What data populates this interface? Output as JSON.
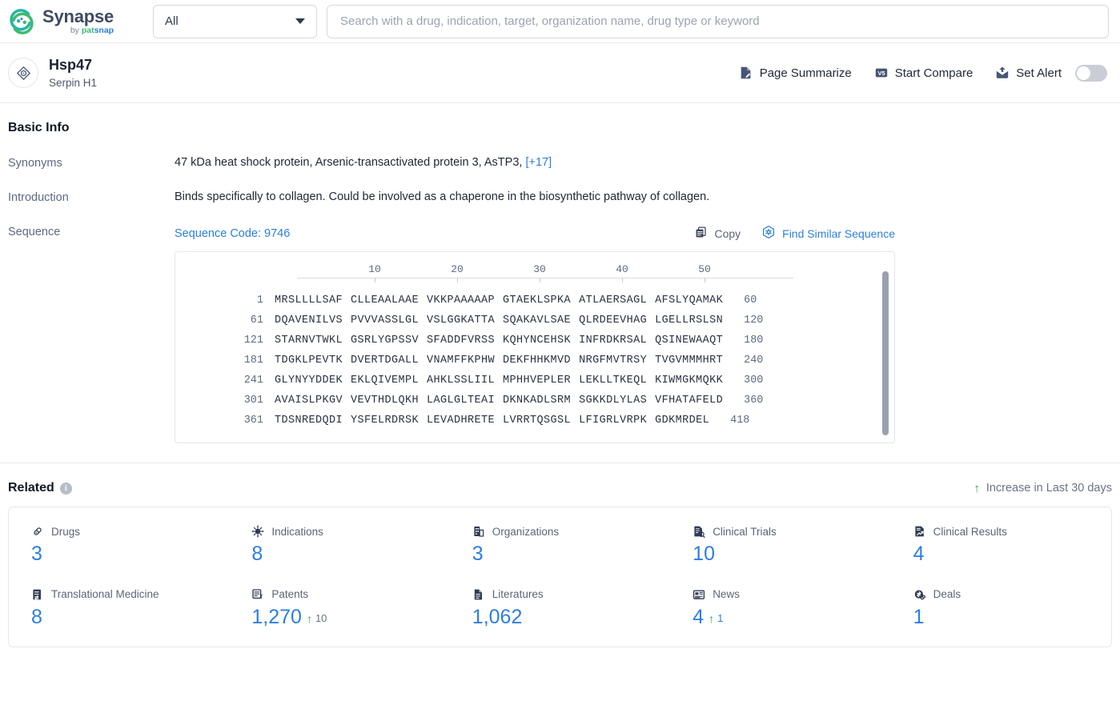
{
  "brand": {
    "name": "Synapse",
    "by": "by ",
    "pat": "pat",
    "snap": "snap",
    "logo_icon": "synapse-swoosh-icon"
  },
  "search": {
    "scope_value": "All",
    "scope_icon": "chevron-down-icon",
    "placeholder": "Search with a drug, indication, target, organization name, drug type or keyword",
    "value": ""
  },
  "entity": {
    "icon": "target-crosshair-icon",
    "title": "Hsp47",
    "subtitle": "Serpin H1",
    "actions": [
      {
        "label": "Page Summarize",
        "icon": "page-summarize-icon"
      },
      {
        "label": "Start Compare",
        "icon": "v5-compare-icon"
      },
      {
        "label": "Set Alert",
        "icon": "alert-envelope-icon"
      }
    ],
    "alert_toggle_state": "off"
  },
  "basic_info": {
    "title": "Basic Info",
    "synonyms": {
      "label": "Synonyms",
      "value": "47 kDa heat shock protein,  Arsenic-transactivated protein 3,  AsTP3,",
      "more": "[+17]"
    },
    "introduction": {
      "label": "Introduction",
      "value": "Binds specifically to collagen. Could be involved as a chaperone in the biosynthetic pathway of collagen."
    },
    "sequence": {
      "label": "Sequence",
      "code_label": "Sequence Code: 9746",
      "copy_label": "Copy",
      "copy_icon": "copy-icon",
      "find_similar_label": "Find Similar Sequence",
      "find_similar_icon": "hexagon-similar-icon",
      "ruler_ticks": [
        "10",
        "20",
        "30",
        "40",
        "50"
      ],
      "rows": [
        {
          "start": "1",
          "blocks": [
            "MRSLLLLSAF",
            "CLLEAALAAE",
            "VKKPAAAAAP",
            "GTAEKLSPKA",
            "ATLAERSAGL",
            "AFSLYQAMAK"
          ],
          "end": "60"
        },
        {
          "start": "61",
          "blocks": [
            "DQAVENILVS",
            "PVVVASSLGL",
            "VSLGGKATTA",
            "SQAKAVLSAE",
            "QLRDEEVHAG",
            "LGELLRSLSN"
          ],
          "end": "120"
        },
        {
          "start": "121",
          "blocks": [
            "STARNVTWKL",
            "GSRLYGPSSV",
            "SFADDFVRSS",
            "KQHYNCEHSK",
            "INFRDKRSAL",
            "QSINEWAAQT"
          ],
          "end": "180"
        },
        {
          "start": "181",
          "blocks": [
            "TDGKLPEVTK",
            "DVERTDGALL",
            "VNAMFFKPHW",
            "DEKFHHKMVD",
            "NRGFMVTRSY",
            "TVGVMMMHRT"
          ],
          "end": "240"
        },
        {
          "start": "241",
          "blocks": [
            "GLYNYYDDEK",
            "EKLQIVEMPL",
            "AHKLSSLIIL",
            "MPHHVEPLER",
            "LEKLLTKEQL",
            "KIWMGKMQKK"
          ],
          "end": "300"
        },
        {
          "start": "301",
          "blocks": [
            "AVAISLPKGV",
            "VEVTHDLQKH",
            "LAGLGLTEAI",
            "DKNKADLSRM",
            "SGKKDLYLAS",
            "VFHATAFELD"
          ],
          "end": "360"
        },
        {
          "start": "361",
          "blocks": [
            "TDSNREDQDI",
            "YSFELRDRSK",
            "LEVADHRETE",
            "LVRRTQSGSL",
            "LFIGRLVRPK",
            "GDKMRDEL"
          ],
          "end": "418"
        }
      ]
    }
  },
  "related": {
    "title": "Related",
    "info_icon": "info-icon",
    "info_glyph": "i",
    "legend_arrow": "↑",
    "legend_label": "Increase in Last 30 days",
    "stats_row1": [
      {
        "label": "Drugs",
        "icon": "pill-icon",
        "value": "3",
        "delta": null
      },
      {
        "label": "Indications",
        "icon": "virus-icon",
        "value": "8",
        "delta": null
      },
      {
        "label": "Organizations",
        "icon": "building-icon",
        "value": "3",
        "delta": null
      },
      {
        "label": "Clinical Trials",
        "icon": "clinical-trial-icon",
        "value": "10",
        "delta": null
      },
      {
        "label": "Clinical Results",
        "icon": "clinical-result-icon",
        "value": "4",
        "delta": null
      }
    ],
    "stats_row2": [
      {
        "label": "Translational Medicine",
        "icon": "translational-medicine-icon",
        "value": "8",
        "delta": null
      },
      {
        "label": "Patents",
        "icon": "patent-icon",
        "value": "1,270",
        "delta": "10",
        "delta_arrow": "↑",
        "delta_color": "gray"
      },
      {
        "label": "Literatures",
        "icon": "literature-icon",
        "value": "1,062",
        "delta": null
      },
      {
        "label": "News",
        "icon": "news-icon",
        "value": "4",
        "delta": "1",
        "delta_arrow": "↑",
        "delta_color": "blue"
      },
      {
        "label": "Deals",
        "icon": "deals-icon",
        "value": "1",
        "delta": null
      }
    ]
  },
  "colors": {
    "accent_blue": "#2b7fe0",
    "green": "#21a84a",
    "label_gray": "#5b6476",
    "icon_navy": "#2f3b52"
  }
}
